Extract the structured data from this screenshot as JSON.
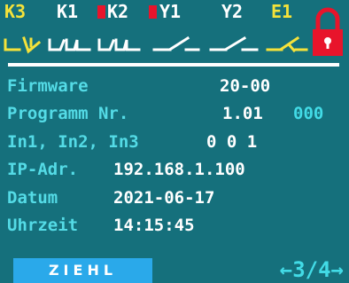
{
  "channels": [
    {
      "label": "K3",
      "active": true
    },
    {
      "label": "K1",
      "active": false
    },
    {
      "label": "K2",
      "active": false
    },
    {
      "label": "Y1",
      "active": false
    },
    {
      "label": "Y2",
      "active": false
    },
    {
      "label": "E1",
      "active": true
    }
  ],
  "lock": {
    "icon": "lock-icon",
    "state": "locked"
  },
  "info": {
    "firmware": {
      "label": "Firmware",
      "value": "20-00"
    },
    "program": {
      "label": "Programm Nr.",
      "value": "1.01",
      "extra": "000"
    },
    "inputs": {
      "label": "In1, In2, In3",
      "value": "0 0 1"
    },
    "ip": {
      "label": "IP-Adr.",
      "value": "192.168.1.100"
    },
    "date": {
      "label": "Datum",
      "value": "2021-06-17"
    },
    "time": {
      "label": "Uhrzeit",
      "value": "14:15:45"
    }
  },
  "footer": {
    "logo": "ZIEHL",
    "prev_icon": "arrow-left-icon",
    "page": "3/4",
    "next_icon": "arrow-right-icon"
  },
  "colors": {
    "background": "#15707c",
    "active_channel": "#f5e23a",
    "label": "#54dbe6",
    "value": "#ffffff",
    "flag": "#e8142b",
    "logo_bg": "#2aa9ea"
  }
}
